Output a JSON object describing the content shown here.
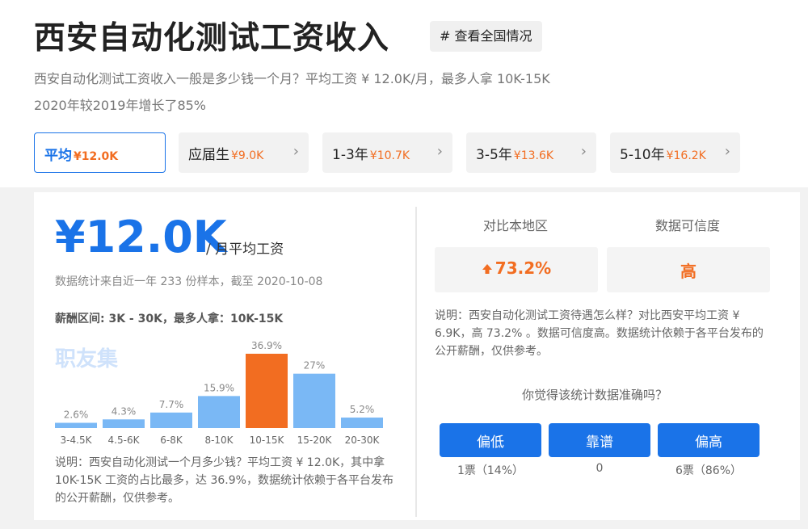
{
  "header": {
    "title": "西安自动化测试工资收入",
    "national_button": "# 查看全国情况",
    "subtitle_line1": "西安自动化测试工资收入一般是多少钱一个月？平均工资 ¥ 12.0K/月，最多人拿 10K-15K",
    "subtitle_line2": "2020年较2019年增长了85%"
  },
  "tabs": [
    {
      "label": "平均",
      "value": "¥12.0K",
      "active": true
    },
    {
      "label": "应届生",
      "value": "¥9.0K",
      "chevron": "›"
    },
    {
      "label": "1-3年",
      "value": "¥10.7K",
      "chevron": "›"
    },
    {
      "label": "3-5年",
      "value": "¥13.6K",
      "chevron": "›"
    },
    {
      "label": "5-10年",
      "value": "¥16.2K",
      "chevron": "›"
    }
  ],
  "summary": {
    "big_value": "¥12.0K",
    "unit": "/ 月平均工资",
    "stat_note": "数据统计来自近一年 233 份样本，截至 2020-10-08",
    "range_note": "薪酬区间: 3K - 30K，最多人拿：10K-15K",
    "watermark": "职友集",
    "explanation": "说明：西安自动化测试一个月多少钱？平均工资 ¥ 12.0K，其中拿 10K-15K 工资的占比最多，达 36.9%，数据统计依赖于各平台发布的公开薪酬，仅供参考。"
  },
  "chart_data": {
    "type": "bar",
    "categories": [
      "3-4.5K",
      "4.5-6K",
      "6-8K",
      "8-10K",
      "10-15K",
      "15-20K",
      "20-30K"
    ],
    "values": [
      2.6,
      4.3,
      7.7,
      15.9,
      36.9,
      27,
      5.2
    ],
    "value_labels": [
      "2.6%",
      "4.3%",
      "7.7%",
      "15.9%",
      "36.9%",
      "27%",
      "5.2%"
    ],
    "highlight_index": 4,
    "colors": {
      "bar": "#7ab8f5",
      "highlight": "#f26d21",
      "label": "#888888"
    },
    "ylim": [
      0,
      36.9
    ],
    "grid": false,
    "legend": "none"
  },
  "comparison": {
    "region_label": "对比本地区",
    "region_icon": "arrow-up-icon",
    "region_value": "73.2%",
    "confidence_label": "数据可信度",
    "confidence_value": "高",
    "explanation": "说明：西安自动化测试工资待遇怎么样？对比西安平均工资 ¥ 6.9K，高 73.2% 。数据可信度高。数据统计依赖于各平台发布的公开薪酬，仅供参考。"
  },
  "vote": {
    "question": "你觉得该统计数据准确吗？",
    "options": [
      {
        "label": "偏低",
        "count": "1票（14%）"
      },
      {
        "label": "靠谱",
        "count": "0"
      },
      {
        "label": "偏高",
        "count": "6票（86%）"
      }
    ]
  },
  "colors": {
    "accent": "#1a73e8",
    "orange": "#f26d21",
    "panel_bg": "#f2f2f2"
  }
}
